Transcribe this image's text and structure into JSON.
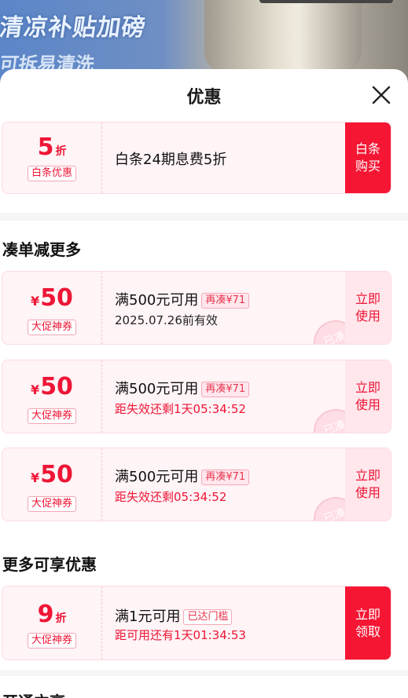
{
  "background": {
    "banner_line1": "清凉补贴加磅",
    "banner_line2": "可拆易清洗"
  },
  "sheet": {
    "title": "优惠",
    "close_icon": "close-icon"
  },
  "top_coupon": {
    "amount": "5",
    "unit": "折",
    "tag": "白条优惠",
    "description": "白条24期息费5折",
    "button": "白条\n购买"
  },
  "sections": {
    "more_items": "凑单减更多",
    "more_offers": "更多可享优惠",
    "open_partial": "开通立享"
  },
  "coupons": [
    {
      "currency": "¥",
      "amount": "50",
      "tag": "大促神券",
      "condition": "满500元可用",
      "pill": "再凑¥71",
      "sub": "2025.07.26前有效",
      "button": "立即\n使用",
      "stamp": "已凑"
    },
    {
      "currency": "¥",
      "amount": "50",
      "tag": "大促神券",
      "condition": "满500元可用",
      "pill": "再凑¥71",
      "sub": "距失效还剩1天05:34:52",
      "button": "立即\n使用",
      "stamp": "已凑"
    },
    {
      "currency": "¥",
      "amount": "50",
      "tag": "大促神券",
      "condition": "满500元可用",
      "pill": "再凑¥71",
      "sub": "距失效还剩05:34:52",
      "button": "立即\n使用",
      "stamp": "已凑"
    }
  ],
  "extra_coupon": {
    "amount": "9",
    "unit": "折",
    "tag": "大促神券",
    "condition": "满1元可用",
    "pill": "已达门槛",
    "sub": "距可用还有1天01:34:53",
    "button": "立即\n领取"
  },
  "colors": {
    "accent": "#f51634",
    "card_bg": "#fff4f6",
    "pill_bg": "#ffe7ec"
  }
}
